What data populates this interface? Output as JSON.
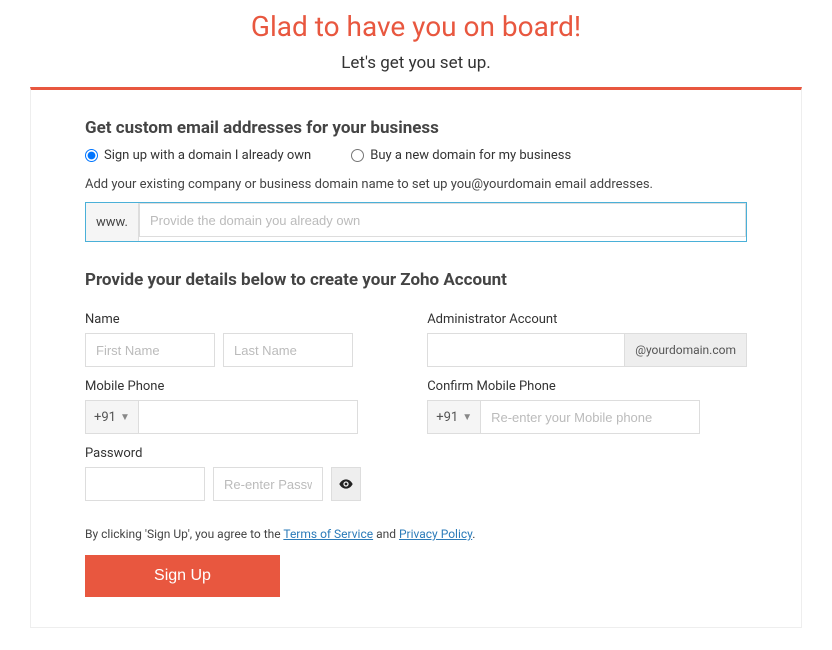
{
  "header": {
    "title": "Glad to have you on board!",
    "subtitle": "Let's get you set up."
  },
  "domainSection": {
    "heading": "Get custom email addresses for your business",
    "radio_own": "Sign up with a domain I already own",
    "radio_buy": "Buy a new domain for my business",
    "helper": "Add your existing company or business domain name to set up you@yourdomain email addresses.",
    "prefix": "www.",
    "placeholder": "Provide the domain you already own"
  },
  "accountSection": {
    "heading": "Provide your details below to create your Zoho Account",
    "labels": {
      "name": "Name",
      "admin": "Administrator Account",
      "mobile": "Mobile Phone",
      "confirm_mobile": "Confirm Mobile Phone",
      "password": "Password"
    },
    "placeholders": {
      "first_name": "First Name",
      "last_name": "Last Name",
      "re_password": "Re-enter Password",
      "confirm_mobile": "Re-enter your Mobile phone"
    },
    "admin_suffix": "@yourdomain.com",
    "dial_code": "+91"
  },
  "terms": {
    "prefix": "By clicking 'Sign Up', you agree to the ",
    "tos": "Terms of Service",
    "mid": " and ",
    "privacy": "Privacy Policy",
    "suffix": "."
  },
  "signup_label": "Sign Up"
}
